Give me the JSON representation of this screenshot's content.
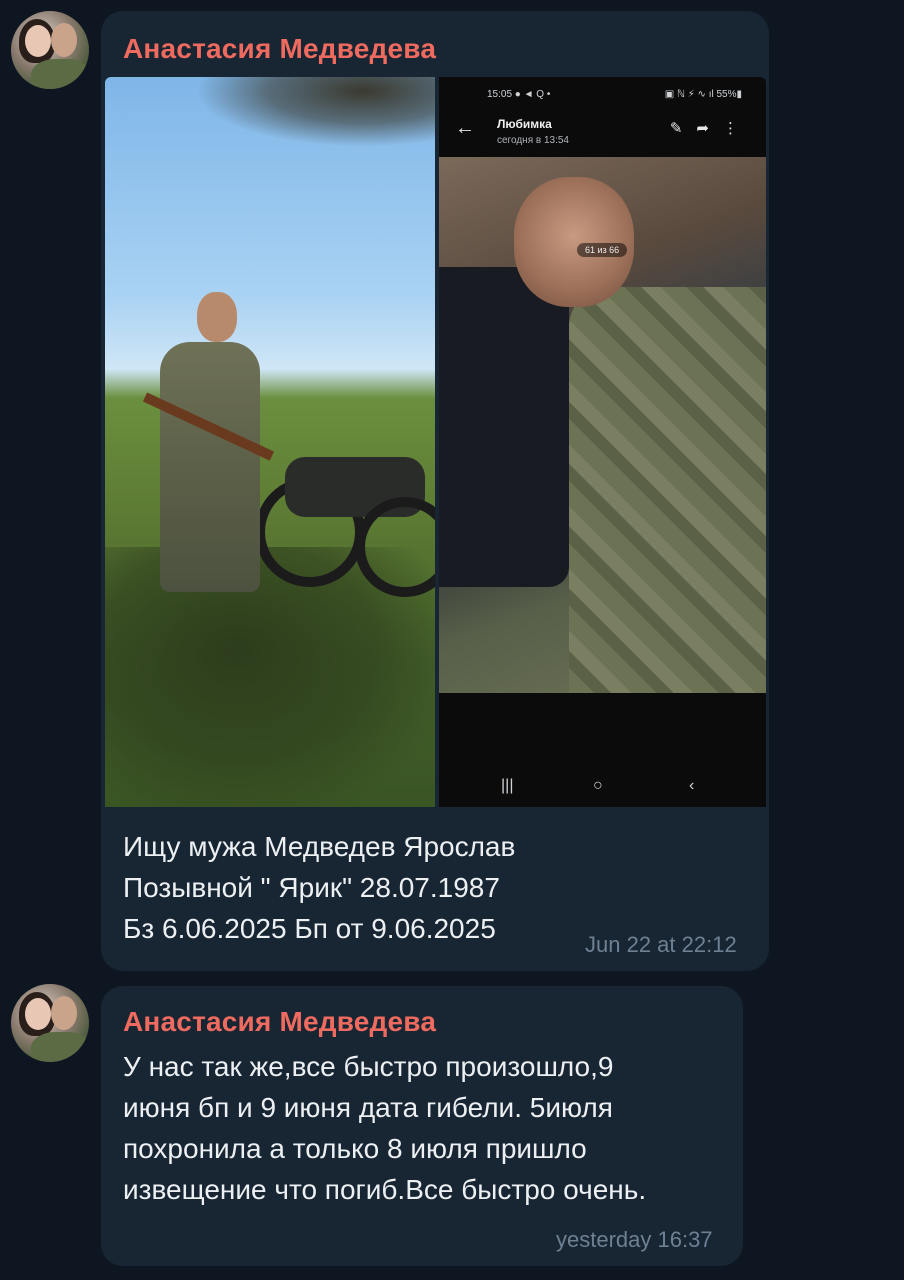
{
  "messages": [
    {
      "sender": "Анастасия Медведева",
      "text": "Ищу мужа Медведев Ярослав\nПозывной \" Ярик\" 28.07.1987\nБз 6.06.2025 Бп от 9.06.2025",
      "time": "Jun 22 at 22:12",
      "attached_screenshot": {
        "status_left": "15:05 ● ◄ Q •",
        "status_right": "▣ ℕ ⚡ ∿ ıl 55%▮",
        "chat_title": "Любимка",
        "chat_subtitle": "сегодня в 13:54",
        "image_counter": "61 из 66",
        "nav_recent": "|||",
        "nav_home": "○",
        "nav_back": "‹"
      }
    },
    {
      "sender": "Анастасия Медведева",
      "text": "У нас так же,все быстро произошло,9\nиюня бп и 9 июня дата гибели. 5июля\nпохронила а только 8 июля пришло\nизвещение что погиб.Все быстро очень.",
      "time": "yesterday 16:37"
    }
  ],
  "colors": {
    "background": "#0e1621",
    "bubble": "#182533",
    "sender_name": "#ef6a5f",
    "message_text": "#ecf0f3",
    "timestamp": "#6e8193"
  }
}
